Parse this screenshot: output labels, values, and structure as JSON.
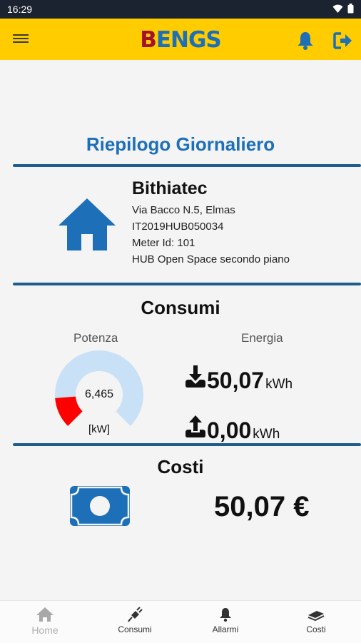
{
  "status_bar": {
    "time": "16:29"
  },
  "app_bar": {
    "logo_b": "B",
    "logo_rest": "ENGS",
    "menu_icon": "hamburger-menu-icon",
    "bell_icon": "bell-icon",
    "logout_icon": "logout-icon"
  },
  "page_title": "Riepilogo Giornaliero",
  "site": {
    "name": "Bithiatec",
    "address": "Via Bacco N.5, Elmas",
    "code": "IT2019HUB050034",
    "meter": "Meter Id: 101",
    "description": "HUB Open Space secondo piano",
    "icon": "home-icon"
  },
  "consumi": {
    "title": "Consumi",
    "power_label": "Potenza",
    "energy_label": "Energia",
    "power_value": "6,465",
    "power_unit": "[kW]",
    "power_fraction": 0.15,
    "energy_in": {
      "value": "50,07",
      "unit": "kWh",
      "icon": "download-icon"
    },
    "energy_out": {
      "value": "0,00",
      "unit": "kWh",
      "icon": "upload-icon"
    }
  },
  "costi": {
    "title": "Costi",
    "value": "50,07 €",
    "icon": "money-icon"
  },
  "bottom_nav": [
    {
      "label": "Home",
      "icon": "home-icon"
    },
    {
      "label": "Consumi",
      "icon": "plug-icon"
    },
    {
      "label": "Allarmi",
      "icon": "bell-icon"
    },
    {
      "label": "Costi",
      "icon": "money-stack-icon"
    }
  ],
  "colors": {
    "accent": "#1d6fb8",
    "app_bar": "#ffcc00",
    "gauge_track": "#c9e1f6",
    "gauge_fill": "#ff0000"
  }
}
